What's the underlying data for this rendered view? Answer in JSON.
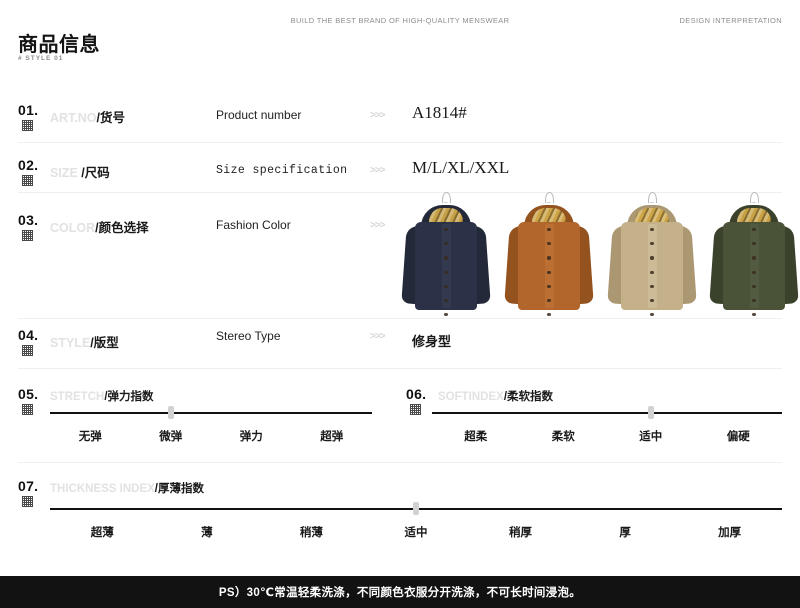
{
  "header": {
    "center_tagline": "BUILD THE BEST BRAND OF HIGH-QUALITY MENSWEAR",
    "right_tagline": "DESIGN INTERPRETATION",
    "title": "商品信息",
    "subtitle": "# STYLE 01"
  },
  "chevron": ">>>",
  "rows": [
    {
      "num": "01.",
      "label_en": "ART.NO",
      "label_cn": "/货号",
      "desc": "Product number",
      "value": "A1814#"
    },
    {
      "num": "02.",
      "label_en": "SIZE",
      "label_cn": " /尺码",
      "desc": "Size specification",
      "value": "M/L/XL/XXL"
    },
    {
      "num": "03.",
      "label_en": "COLOR",
      "label_cn": "/颜色选择",
      "desc": "Fashion Color",
      "value": ""
    },
    {
      "num": "04.",
      "label_en": "STYLE",
      "label_cn": "/版型",
      "desc": "Stereo Type",
      "value": "修身型"
    }
  ],
  "colors": {
    "navy": "#2b3248",
    "camel": "#b2662b",
    "khaki": "#c4b189",
    "olive": "#4a5238",
    "hanger": "#bdbdbd",
    "marker": "#d2d2d2",
    "line": "#111111",
    "divider": "#efefef",
    "ghost_text": "#e2e2e2",
    "footer_bg": "#121212"
  },
  "swatches": [
    {
      "name": "navy",
      "hex": "#2b3248",
      "shade": "#232938",
      "light": "#3a4258"
    },
    {
      "name": "camel",
      "hex": "#b2662b",
      "shade": "#94521f",
      "light": "#c4773a"
    },
    {
      "name": "khaki",
      "hex": "#c4b189",
      "shade": "#ab9872",
      "light": "#d3c3a0"
    },
    {
      "name": "olive",
      "hex": "#4a5238",
      "shade": "#3b422c",
      "light": "#596247"
    }
  ],
  "scales": [
    {
      "num": "05.",
      "label_en": "STRETCH",
      "label_cn": "/弹力指数",
      "ticks": [
        "无弹",
        "微弹",
        "弹力",
        "超弹"
      ],
      "selected_index": 1
    },
    {
      "num": "06.",
      "label_en": "SOFTINDEX",
      "label_cn": "/柔软指数",
      "ticks": [
        "超柔",
        "柔软",
        "适中",
        "偏硬"
      ],
      "selected_index": 2
    },
    {
      "num": "07.",
      "label_en": "THICKNESS INDEX",
      "label_cn": "/厚薄指数",
      "ticks": [
        "超薄",
        "薄",
        "稍薄",
        "适中",
        "稍厚",
        "厚",
        "加厚"
      ],
      "selected_index": 3
    }
  ],
  "footer": {
    "note": "PS）30℃常温轻柔洗涤，不同颜色衣服分开洗涤，不可长时间浸泡。"
  }
}
